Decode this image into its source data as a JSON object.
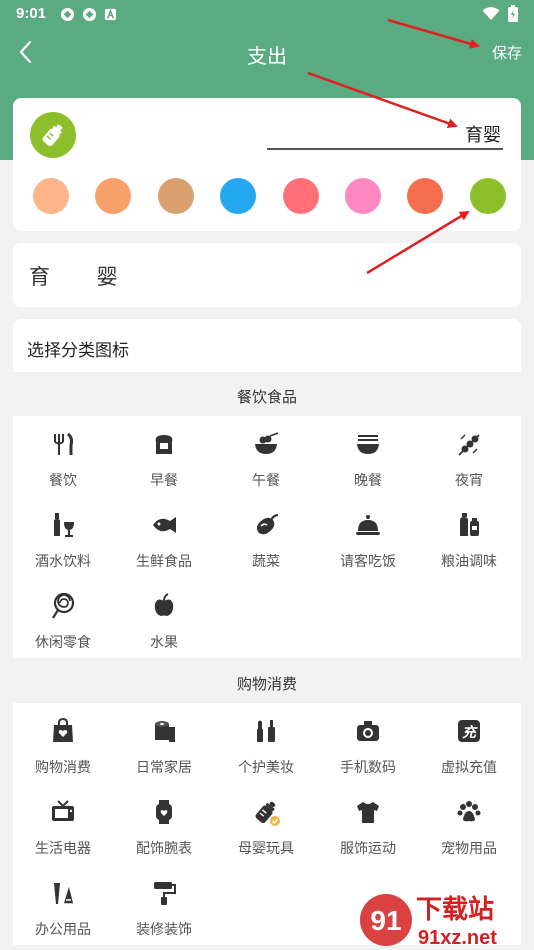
{
  "status": {
    "time": "9:01"
  },
  "nav": {
    "title": "支出",
    "save_label": "保存"
  },
  "editor": {
    "name_value": "育婴",
    "preview_text": "育 婴",
    "selected_color": "#8cbf2a"
  },
  "colors": [
    "#ffb48a",
    "#f8a06a",
    "#d8a06e",
    "#26a8f0",
    "#ff7078",
    "#ff88c0",
    "#f56e50",
    "#8cbf2a"
  ],
  "choose_label": "选择分类图标",
  "sections": [
    {
      "title": "餐饮食品",
      "items": [
        {
          "label": "餐饮",
          "icon": "utensils-icon"
        },
        {
          "label": "早餐",
          "icon": "toast-icon"
        },
        {
          "label": "午餐",
          "icon": "rice-bowl-icon"
        },
        {
          "label": "晚餐",
          "icon": "noodle-bowl-icon"
        },
        {
          "label": "夜宵",
          "icon": "skewer-icon"
        },
        {
          "label": "酒水饮料",
          "icon": "wine-icon"
        },
        {
          "label": "生鲜食品",
          "icon": "fish-icon"
        },
        {
          "label": "蔬菜",
          "icon": "eggplant-icon"
        },
        {
          "label": "请客吃饭",
          "icon": "cloche-icon"
        },
        {
          "label": "粮油调味",
          "icon": "oil-bottle-icon"
        },
        {
          "label": "休闲零食",
          "icon": "lollipop-icon"
        },
        {
          "label": "水果",
          "icon": "apple-icon"
        }
      ]
    },
    {
      "title": "购物消费",
      "items": [
        {
          "label": "购物消费",
          "icon": "shopping-bag-icon"
        },
        {
          "label": "日常家居",
          "icon": "tissue-roll-icon"
        },
        {
          "label": "个护美妆",
          "icon": "makeup-icon"
        },
        {
          "label": "手机数码",
          "icon": "camera-icon"
        },
        {
          "label": "虚拟充值",
          "icon": "recharge-icon",
          "glyph": "充"
        },
        {
          "label": "生活电器",
          "icon": "tv-icon"
        },
        {
          "label": "配饰腕表",
          "icon": "watch-icon"
        },
        {
          "label": "母婴玩具",
          "icon": "baby-bottle-icon",
          "selected": true
        },
        {
          "label": "服饰运动",
          "icon": "tshirt-icon"
        },
        {
          "label": "宠物用品",
          "icon": "paw-icon"
        },
        {
          "label": "办公用品",
          "icon": "stationery-icon"
        },
        {
          "label": "装修装饰",
          "icon": "paint-roller-icon"
        }
      ]
    }
  ],
  "watermark": {
    "logo_text": "91",
    "name": "下载站",
    "url": "91xz.net"
  }
}
